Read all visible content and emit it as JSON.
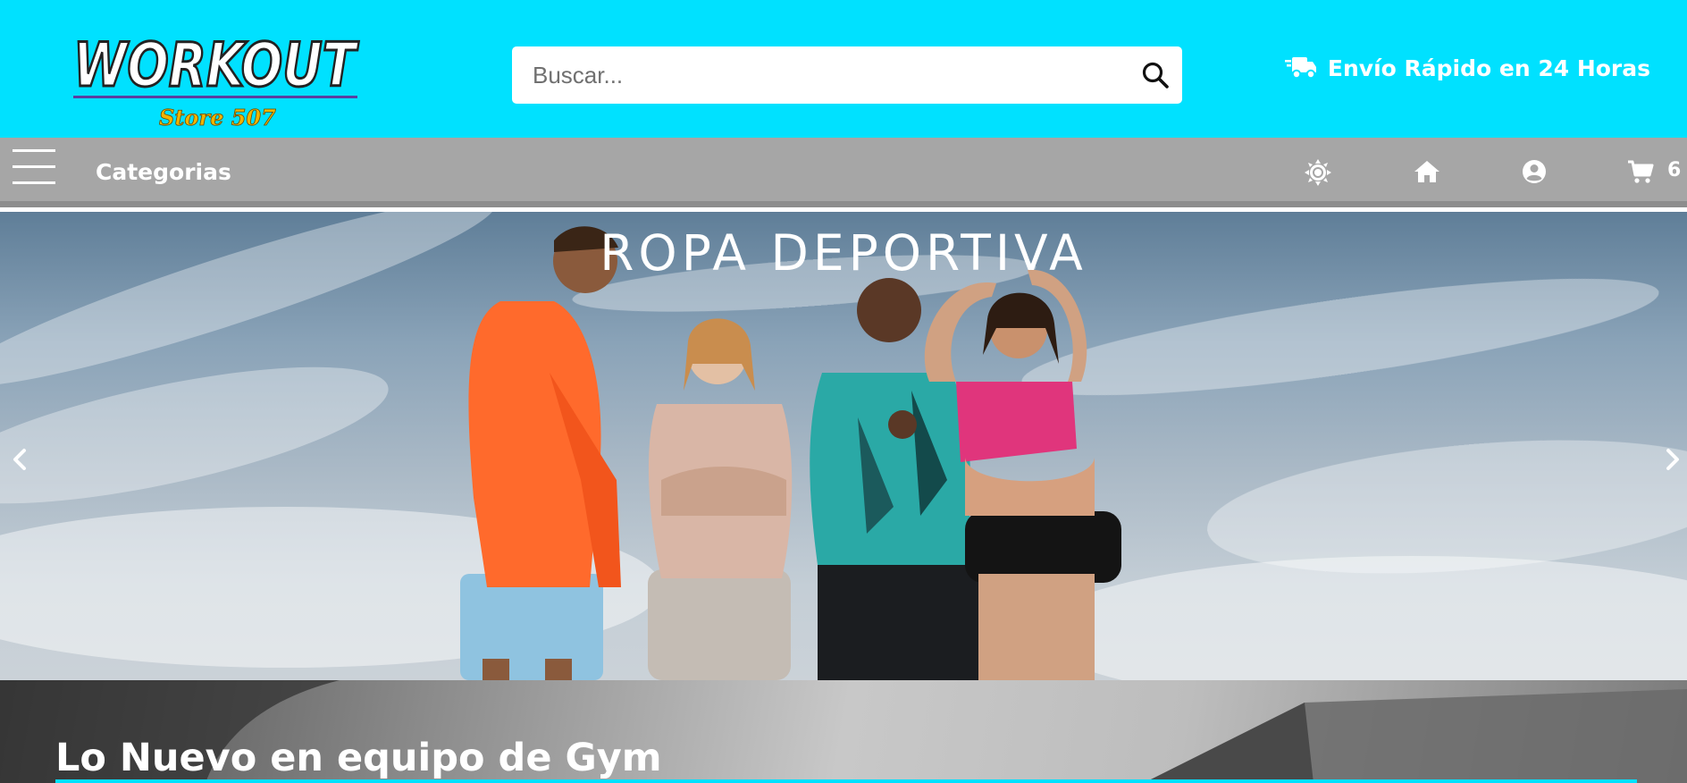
{
  "header": {
    "logo": {
      "wordmark": "WORKOUT",
      "subtitle": "Store 507",
      "colors": {
        "text": "#ffffff",
        "outline": "#222222",
        "underline": "#5a3fa0",
        "subtitle": "#f0b400"
      }
    },
    "search": {
      "placeholder": "Buscar...",
      "icon": "search-icon"
    },
    "shipping": {
      "icon": "truck-fast-icon",
      "label": "Envío Rápido en 24 Horas"
    },
    "background_color": "#00e1ff"
  },
  "navbar": {
    "menu_icon": "hamburger-icon",
    "categories_label": "Categorias",
    "icons": [
      "sun-icon",
      "home-icon",
      "user-circle-icon",
      "cart-icon"
    ],
    "cart_count": "6",
    "background_color": "#a6a6a6"
  },
  "hero": {
    "title": "ROPA DEPORTIVA",
    "prev_icon": "chevron-left-icon",
    "next_icon": "chevron-right-icon"
  },
  "section": {
    "title": "Lo Nuevo en equipo de Gym",
    "accent_color": "#00e1ff"
  }
}
